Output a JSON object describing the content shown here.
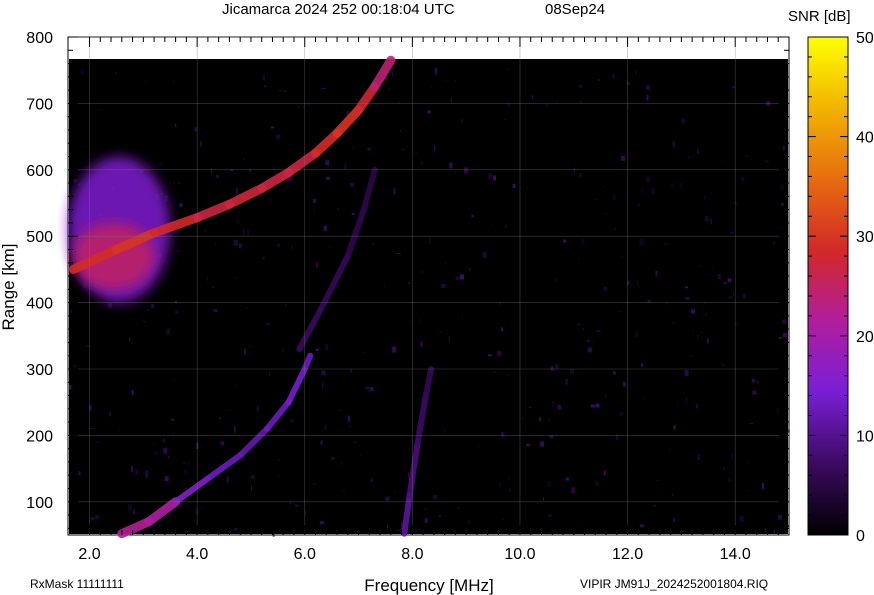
{
  "header": {
    "title": "Jicamarca 2024 252 00:18:04 UTC",
    "date": "08Sep24",
    "colorbar_label": "SNR [dB]"
  },
  "footer": {
    "rx_mask": "RxMask 11111111",
    "file_label": "VIPIR  JM91J_2024252001804.RIQ"
  },
  "chart_data": {
    "type": "heatmap",
    "title": "Jicamarca 2024 252 00:18:04 UTC",
    "xlabel": "Frequency [MHz]",
    "ylabel": "Range [km]",
    "xlim": [
      1.6,
      15.0
    ],
    "ylim": [
      50,
      800
    ],
    "x_ticks": [
      {
        "value": 2.0,
        "label": "2.0"
      },
      {
        "value": 4.0,
        "label": "4.0"
      },
      {
        "value": 6.0,
        "label": "6.0"
      },
      {
        "value": 8.0,
        "label": "8.0"
      },
      {
        "value": 10.0,
        "label": "10.0"
      },
      {
        "value": 12.0,
        "label": "12.0"
      },
      {
        "value": 14.0,
        "label": "14.0"
      }
    ],
    "y_ticks": [
      {
        "value": 100,
        "label": "100"
      },
      {
        "value": 200,
        "label": "200"
      },
      {
        "value": 300,
        "label": "300"
      },
      {
        "value": 400,
        "label": "400"
      },
      {
        "value": 500,
        "label": "500"
      },
      {
        "value": 600,
        "label": "600"
      },
      {
        "value": 700,
        "label": "700"
      },
      {
        "value": 800,
        "label": "800"
      }
    ],
    "grid": true,
    "colorbar": {
      "label": "SNR [dB]",
      "range": [
        0,
        50
      ],
      "ticks": [
        {
          "value": 0,
          "label": "0"
        },
        {
          "value": 10,
          "label": "10"
        },
        {
          "value": 20,
          "label": "20"
        },
        {
          "value": 30,
          "label": "30"
        },
        {
          "value": 40,
          "label": "40"
        },
        {
          "value": 50,
          "label": "50"
        }
      ],
      "colors": [
        "#000000",
        "#3a0a5e",
        "#7a1fd6",
        "#b01e9c",
        "#d32828",
        "#e66a10",
        "#f2b400",
        "#ffff00"
      ]
    },
    "echo_traces": [
      {
        "name": "F-region trace",
        "points": [
          [
            1.7,
            450
          ],
          [
            2.5,
            480
          ],
          [
            3.2,
            505
          ],
          [
            4.0,
            528
          ],
          [
            4.6,
            548
          ],
          [
            5.2,
            572
          ],
          [
            5.7,
            596
          ],
          [
            6.2,
            625
          ],
          [
            6.6,
            655
          ],
          [
            7.0,
            690
          ],
          [
            7.3,
            725
          ],
          [
            7.6,
            765
          ]
        ],
        "snr": [
          28,
          30,
          30,
          27,
          27,
          28,
          26,
          28,
          30,
          30,
          26,
          22
        ]
      },
      {
        "name": "low-range O-trace",
        "points": [
          [
            2.6,
            52
          ],
          [
            3.1,
            70
          ],
          [
            3.6,
            100
          ],
          [
            4.2,
            135
          ],
          [
            4.8,
            170
          ],
          [
            5.3,
            210
          ],
          [
            5.7,
            250
          ],
          [
            6.0,
            300
          ],
          [
            6.1,
            320
          ]
        ],
        "snr": [
          20,
          24,
          18,
          14,
          12,
          12,
          14,
          14,
          12
        ]
      },
      {
        "name": "X-mode faint trace",
        "points": [
          [
            5.9,
            330
          ],
          [
            6.3,
            390
          ],
          [
            6.8,
            470
          ],
          [
            7.1,
            540
          ],
          [
            7.3,
            600
          ]
        ],
        "snr": [
          7,
          7,
          6,
          6,
          5
        ]
      },
      {
        "name": "low-range trace near 8 MHz",
        "points": [
          [
            7.85,
            52
          ],
          [
            7.95,
            110
          ],
          [
            8.1,
            190
          ],
          [
            8.25,
            260
          ],
          [
            8.35,
            300
          ]
        ],
        "snr": [
          12,
          10,
          8,
          7,
          6
        ]
      }
    ],
    "diffuse_regions": [
      {
        "name": "low-frequency spread-F blob",
        "x": [
          1.6,
          3.5
        ],
        "y": [
          400,
          620
        ],
        "snr": 15
      },
      {
        "name": "low-frequency core",
        "x": [
          1.7,
          3.2
        ],
        "y": [
          420,
          520
        ],
        "snr": 25
      }
    ]
  }
}
